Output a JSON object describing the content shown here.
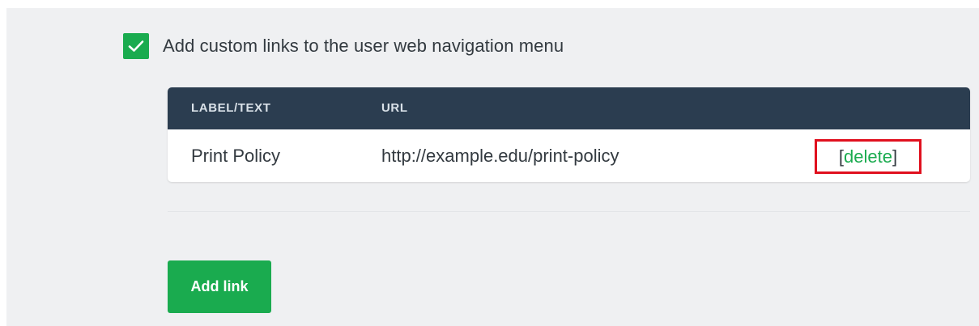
{
  "custom_links_option": {
    "checked": true,
    "label": "Add custom links to the user web navigation menu"
  },
  "links_table": {
    "columns": [
      "LABEL/TEXT",
      "URL"
    ],
    "rows": [
      {
        "label": "Print Policy",
        "url": "http://example.edu/print-policy",
        "action_open": "[",
        "action_text": "delete",
        "action_close": "]"
      }
    ]
  },
  "add_link_button": {
    "label": "Add link"
  },
  "colors": {
    "accent_green": "#1aab4f",
    "header_navy": "#2b3d50",
    "highlight_red": "#e0101e",
    "panel_bg": "#eff0f2"
  },
  "icons": {
    "checkbox": "check-icon"
  }
}
